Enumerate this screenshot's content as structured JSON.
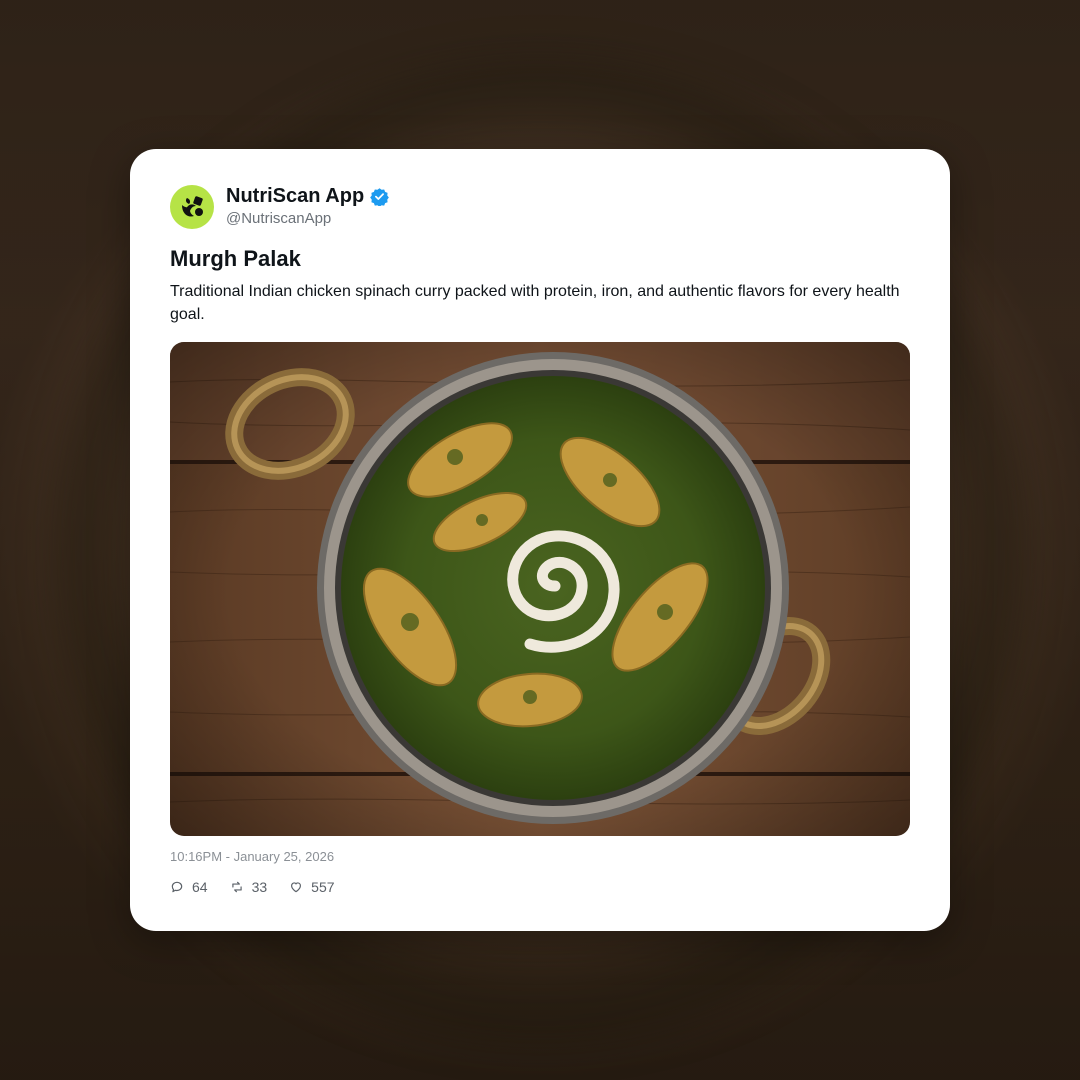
{
  "post": {
    "author": {
      "display_name": "NutriScan App",
      "handle": "@NutriscanApp",
      "verified": true,
      "avatar_icon": "nutriscan-logo-icon",
      "avatar_color": "#b6e346"
    },
    "title": "Murgh Palak",
    "description": "Traditional Indian chicken spinach curry packed with protein, iron, and authentic flavors for every health goal.",
    "timestamp": "10:16PM - January 25, 2026",
    "stats": {
      "replies": "64",
      "reposts": "33",
      "likes": "557"
    }
  },
  "colors": {
    "verified_badge": "#1d9bf0",
    "text_primary": "#0f1419",
    "text_secondary": "#6b7178"
  }
}
